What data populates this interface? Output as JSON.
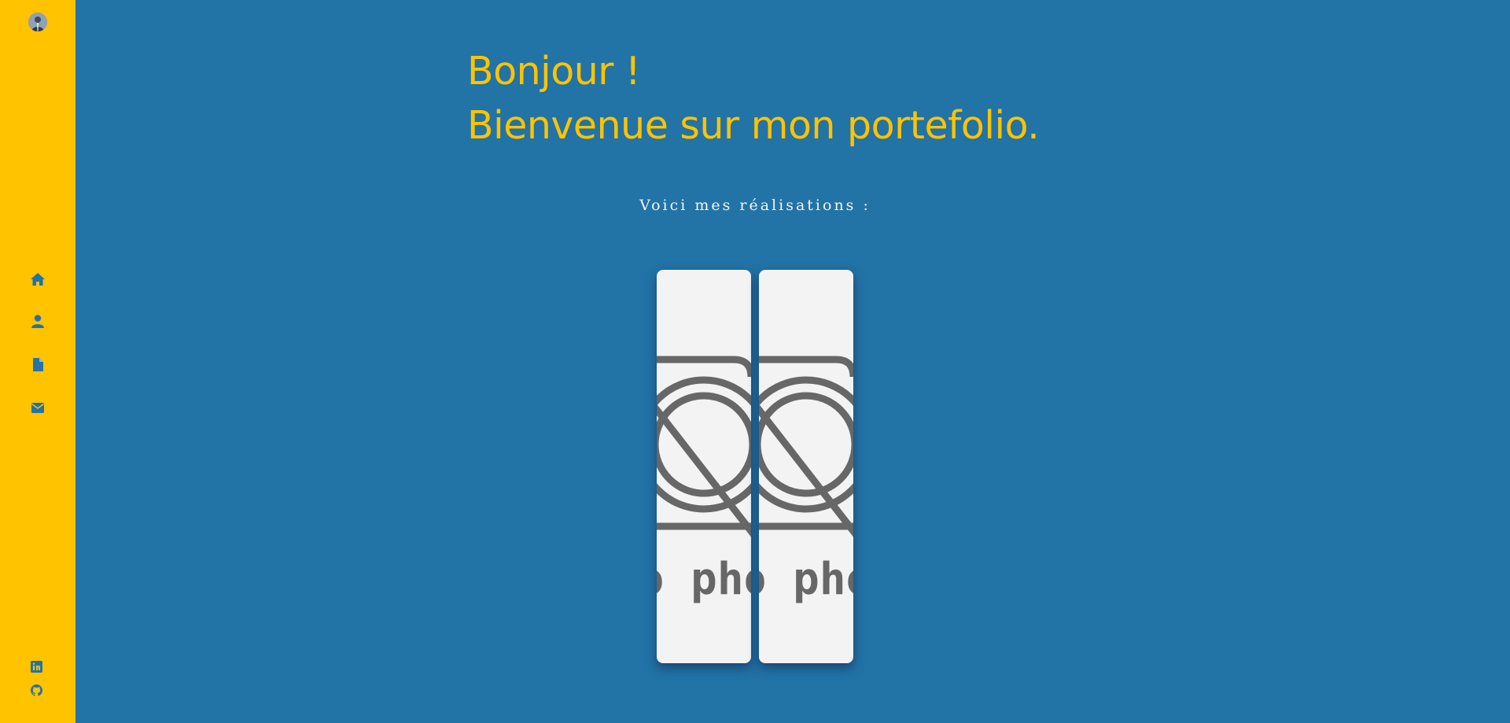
{
  "sidebar": {
    "avatar_icon": "profile-photo",
    "nav": [
      {
        "icon": "home-icon"
      },
      {
        "icon": "user-icon"
      },
      {
        "icon": "document-icon"
      },
      {
        "icon": "envelope-icon"
      }
    ],
    "social": [
      {
        "icon": "linkedin-icon"
      },
      {
        "icon": "github-icon"
      }
    ]
  },
  "main": {
    "greeting_line1": "Bonjour !",
    "greeting_line2": "Bienvenue sur mon portefolio.",
    "subtitle": "Voici mes réalisations :",
    "cards": [
      {
        "placeholder_text": "o pho",
        "icon": "no-photo-icon"
      },
      {
        "placeholder_text": "o pho",
        "icon": "no-photo-icon"
      }
    ]
  },
  "colors": {
    "background": "#2273a6",
    "sidebar": "#ffc300",
    "accent": "#ffc300",
    "card": "#f4f3f4",
    "placeholder": "#666666"
  }
}
